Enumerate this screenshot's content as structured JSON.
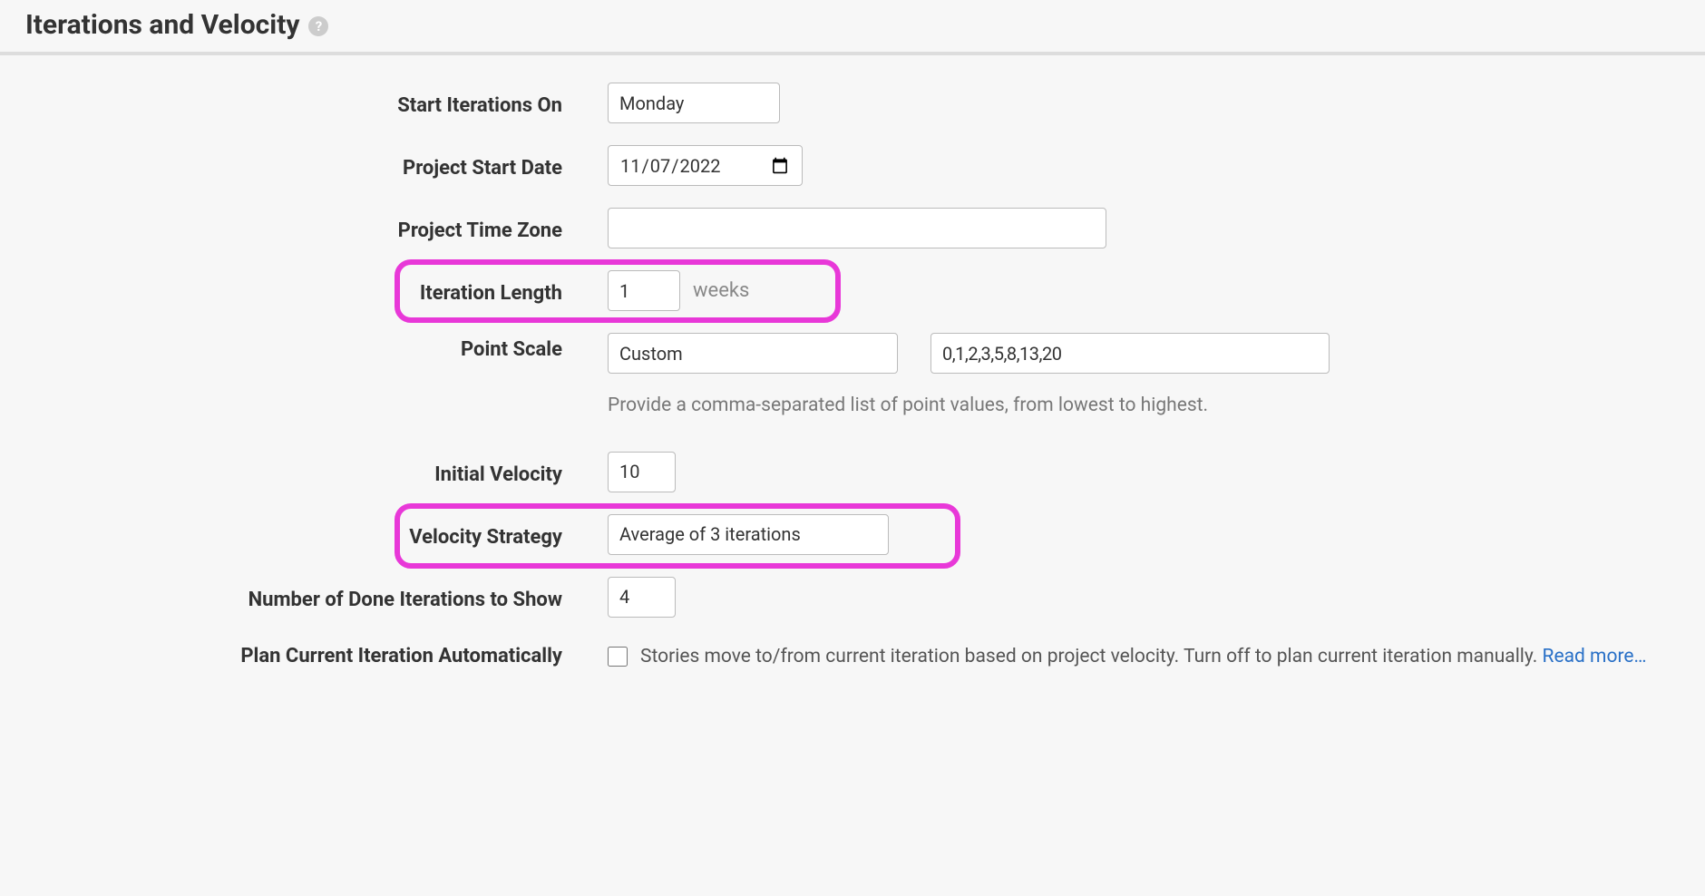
{
  "section": {
    "title": "Iterations and Velocity"
  },
  "form": {
    "start_iterations_on": {
      "label": "Start Iterations On",
      "value": "Monday"
    },
    "project_start_date": {
      "label": "Project Start Date",
      "value": "2022-11-07",
      "display": "2022/11/07"
    },
    "project_time_zone": {
      "label": "Project Time Zone",
      "value": ""
    },
    "iteration_length": {
      "label": "Iteration Length",
      "value": "1",
      "suffix": "weeks"
    },
    "point_scale": {
      "label": "Point Scale",
      "value": "Custom",
      "custom_values": "0,1,2,3,5,8,13,20",
      "help_text": "Provide a comma-separated list of point values, from lowest to highest."
    },
    "initial_velocity": {
      "label": "Initial Velocity",
      "value": "10"
    },
    "velocity_strategy": {
      "label": "Velocity Strategy",
      "value": "Average of 3 iterations"
    },
    "done_iterations": {
      "label": "Number of Done Iterations to Show",
      "value": "4"
    },
    "plan_auto": {
      "label": "Plan Current Iteration Automatically",
      "checked": false,
      "description": "Stories move to/from current iteration based on project velocity. Turn off to plan current iteration manually. ",
      "link_text": "Read more…"
    }
  }
}
